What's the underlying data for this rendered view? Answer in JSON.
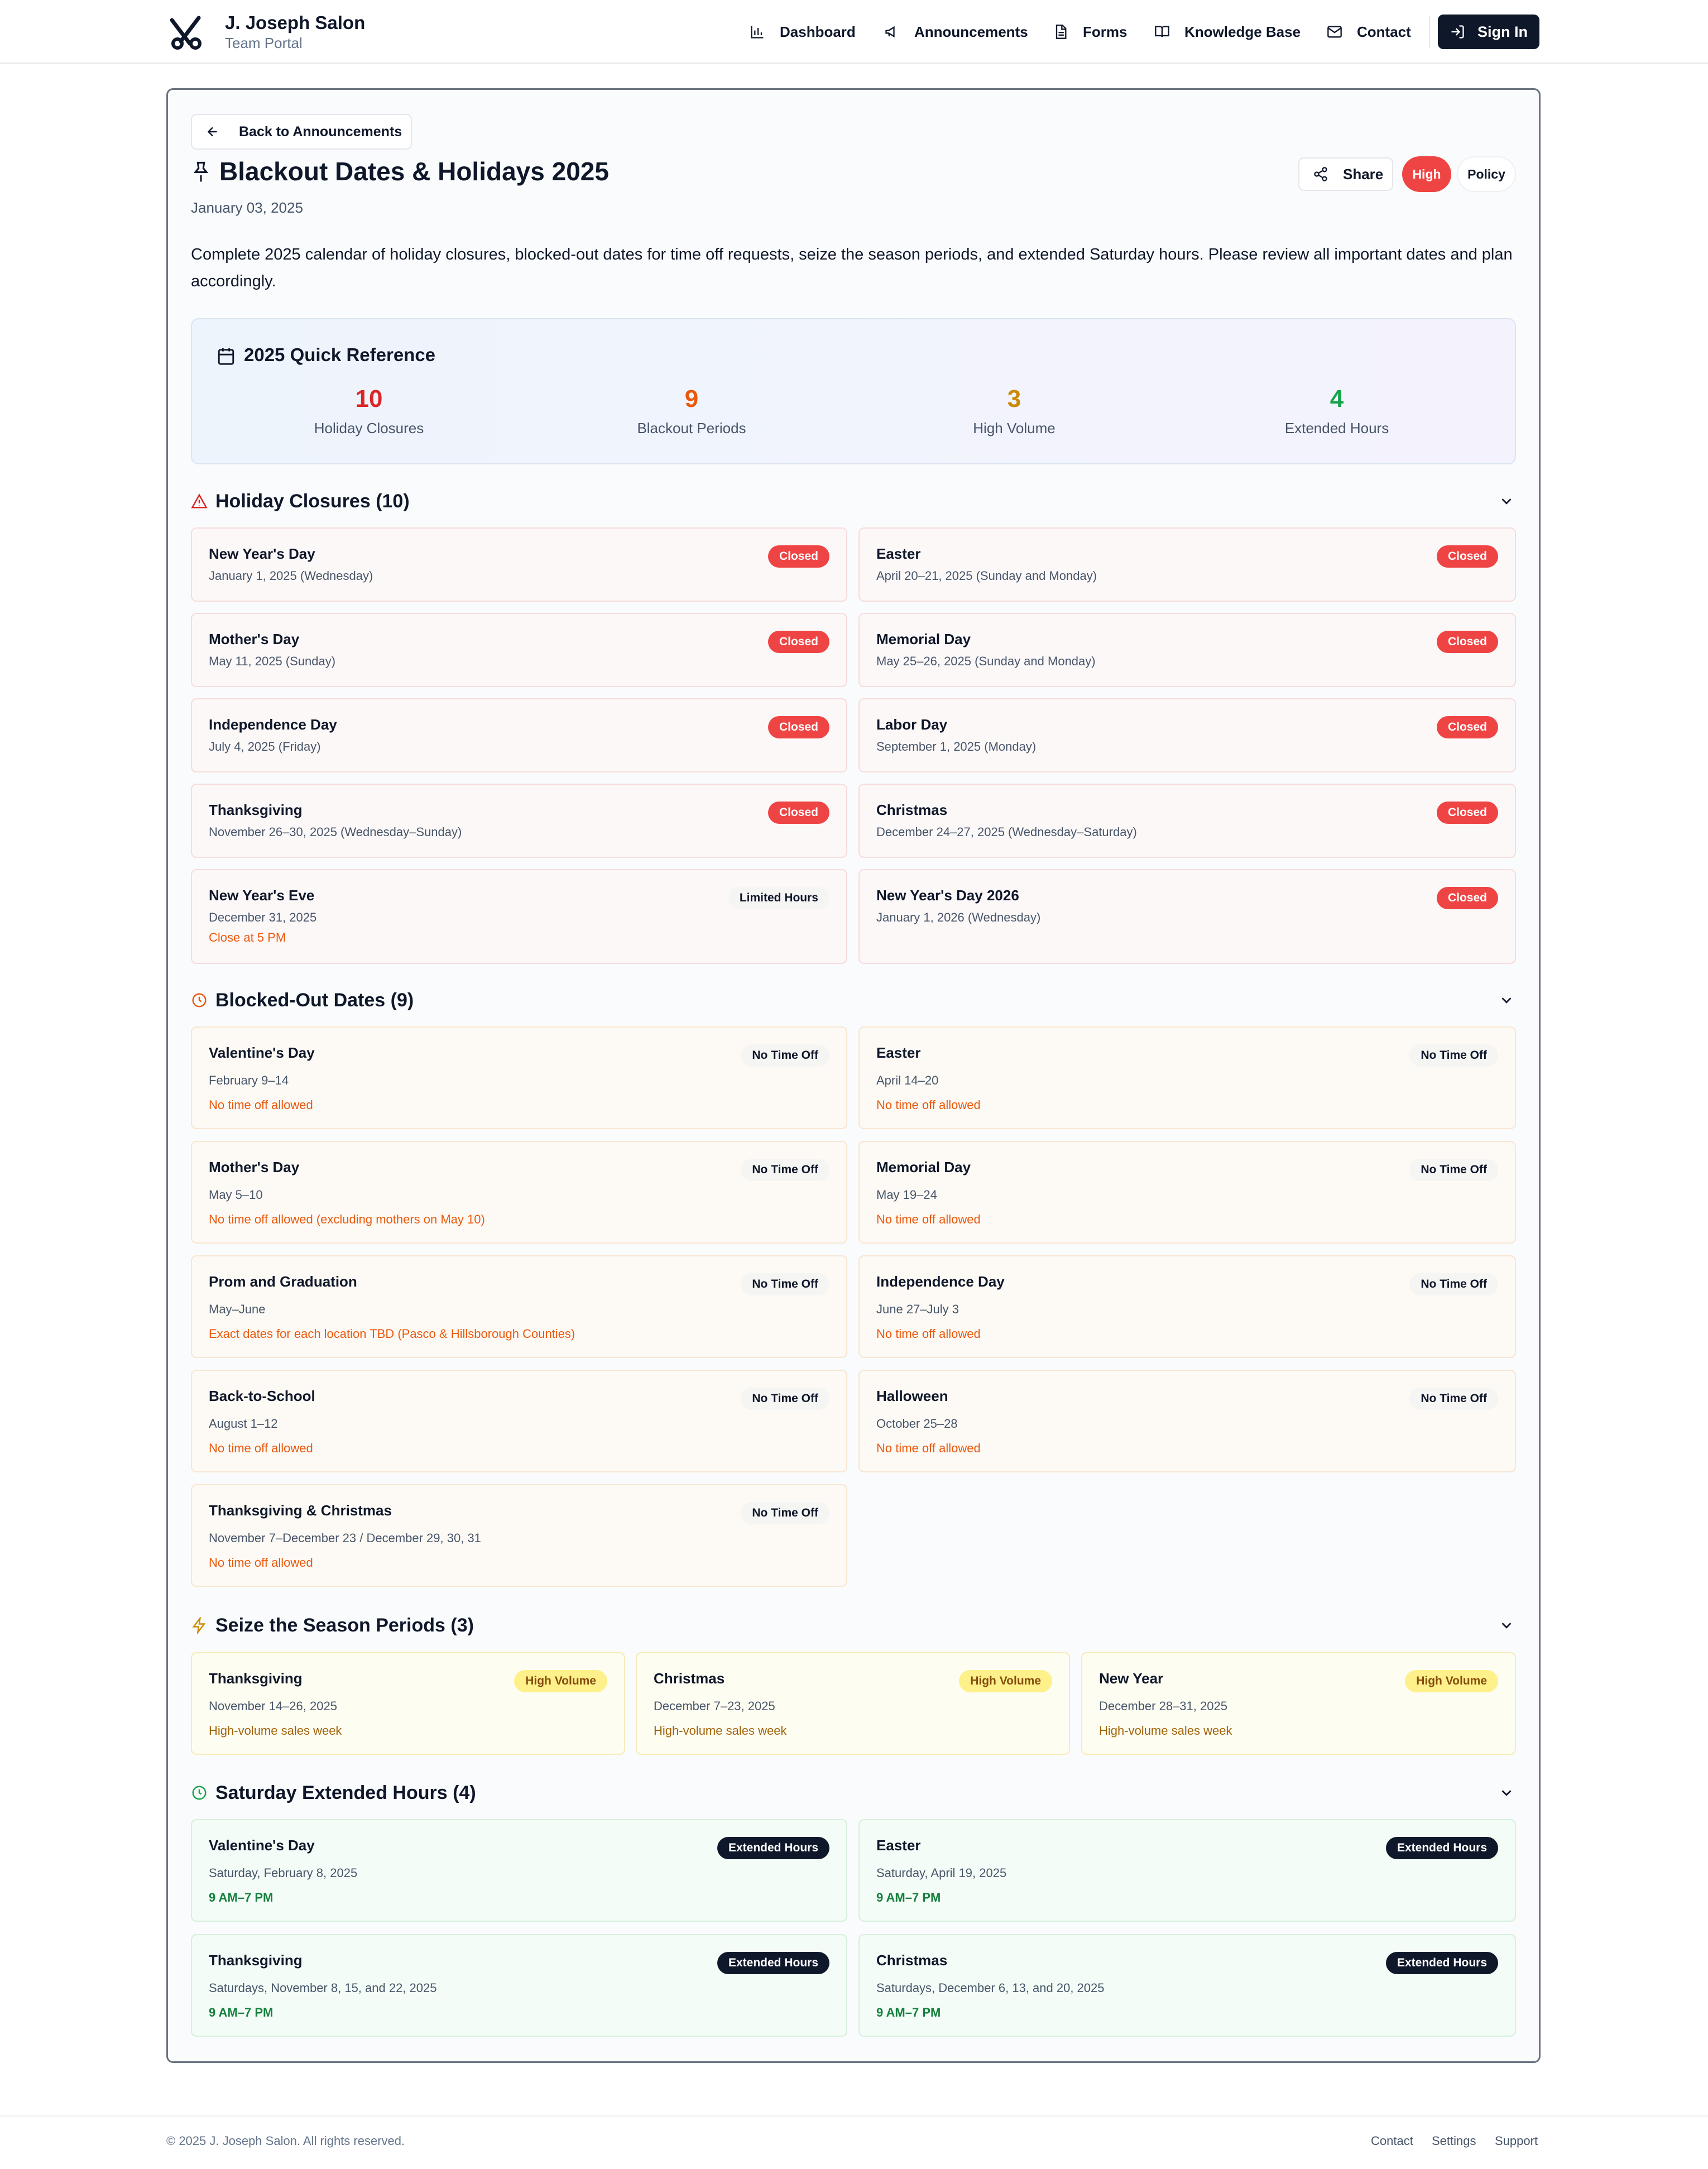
{
  "brand": {
    "name": "J. Joseph Salon",
    "subtitle": "Team Portal"
  },
  "nav": {
    "items": [
      {
        "label": "Dashboard",
        "icon": "bar-chart-icon"
      },
      {
        "label": "Announcements",
        "icon": "megaphone-icon"
      },
      {
        "label": "Forms",
        "icon": "document-icon"
      },
      {
        "label": "Knowledge Base",
        "icon": "book-icon"
      },
      {
        "label": "Contact",
        "icon": "mail-icon"
      }
    ],
    "sign_in": "Sign In"
  },
  "announcement": {
    "back_label": "Back to Announcements",
    "title": "Blackout Dates & Holidays 2025",
    "date": "January 03, 2025",
    "share_label": "Share",
    "priority": "High",
    "category": "Policy",
    "description": "Complete 2025 calendar of holiday closures, blocked-out dates for time off requests, seize the season periods, and extended Saturday hours. Please review all important dates and plan accordingly."
  },
  "quick_reference": {
    "title": "2025 Quick Reference",
    "stats": [
      {
        "value": "10",
        "label": "Holiday Closures",
        "color": "#dc2626"
      },
      {
        "value": "9",
        "label": "Blackout Periods",
        "color": "#ea580c"
      },
      {
        "value": "3",
        "label": "High Volume",
        "color": "#ca8a04"
      },
      {
        "value": "4",
        "label": "Extended Hours",
        "color": "#16a34a"
      }
    ]
  },
  "holiday_closures": {
    "title": "Holiday Closures (10)",
    "items": [
      {
        "name": "New Year's Day",
        "date": "January 1, 2025 (Wednesday)",
        "badge": "Closed"
      },
      {
        "name": "Easter",
        "date": "April 20–21, 2025 (Sunday and Monday)",
        "badge": "Closed"
      },
      {
        "name": "Mother's Day",
        "date": "May 11, 2025 (Sunday)",
        "badge": "Closed"
      },
      {
        "name": "Memorial Day",
        "date": "May 25–26, 2025 (Sunday and Monday)",
        "badge": "Closed"
      },
      {
        "name": "Independence Day",
        "date": "July 4, 2025 (Friday)",
        "badge": "Closed"
      },
      {
        "name": "Labor Day",
        "date": "September 1, 2025 (Monday)",
        "badge": "Closed"
      },
      {
        "name": "Thanksgiving",
        "date": "November 26–30, 2025 (Wednesday–Sunday)",
        "badge": "Closed"
      },
      {
        "name": "Christmas",
        "date": "December 24–27, 2025 (Wednesday–Saturday)",
        "badge": "Closed"
      },
      {
        "name": "New Year's Eve",
        "date": "December 31, 2025",
        "badge": "Limited Hours",
        "note": "Close at 5 PM"
      },
      {
        "name": "New Year's Day 2026",
        "date": "January 1, 2026 (Wednesday)",
        "badge": "Closed"
      }
    ]
  },
  "blocked_out": {
    "title": "Blocked-Out Dates (9)",
    "items": [
      {
        "name": "Valentine's Day",
        "date": "February 9–14",
        "badge": "No Time Off",
        "note": "No time off allowed"
      },
      {
        "name": "Easter",
        "date": "April 14–20",
        "badge": "No Time Off",
        "note": "No time off allowed"
      },
      {
        "name": "Mother's Day",
        "date": "May 5–10",
        "badge": "No Time Off",
        "note": "No time off allowed (excluding mothers on May 10)"
      },
      {
        "name": "Memorial Day",
        "date": "May 19–24",
        "badge": "No Time Off",
        "note": "No time off allowed"
      },
      {
        "name": "Prom and Graduation",
        "date": "May–June",
        "badge": "No Time Off",
        "note": "Exact dates for each location TBD (Pasco & Hillsborough Counties)"
      },
      {
        "name": "Independence Day",
        "date": "June 27–July 3",
        "badge": "No Time Off",
        "note": "No time off allowed"
      },
      {
        "name": "Back-to-School",
        "date": "August 1–12",
        "badge": "No Time Off",
        "note": "No time off allowed"
      },
      {
        "name": "Halloween",
        "date": "October 25–28",
        "badge": "No Time Off",
        "note": "No time off allowed"
      },
      {
        "name": "Thanksgiving & Christmas",
        "date": "November 7–December 23 / December 29, 30, 31",
        "badge": "No Time Off",
        "note": "No time off allowed"
      }
    ]
  },
  "seize_season": {
    "title": "Seize the Season Periods (3)",
    "items": [
      {
        "name": "Thanksgiving",
        "date": "November 14–26, 2025",
        "badge": "High Volume",
        "note": "High-volume sales week"
      },
      {
        "name": "Christmas",
        "date": "December 7–23, 2025",
        "badge": "High Volume",
        "note": "High-volume sales week"
      },
      {
        "name": "New Year",
        "date": "December 28–31, 2025",
        "badge": "High Volume",
        "note": "High-volume sales week"
      }
    ]
  },
  "saturday_hours": {
    "title": "Saturday Extended Hours (4)",
    "items": [
      {
        "name": "Valentine's Day",
        "date": "Saturday, February 8, 2025",
        "badge": "Extended Hours",
        "note": "9 AM–7 PM"
      },
      {
        "name": "Easter",
        "date": "Saturday, April 19, 2025",
        "badge": "Extended Hours",
        "note": "9 AM–7 PM"
      },
      {
        "name": "Thanksgiving",
        "date": "Saturdays, November 8, 15, and 22, 2025",
        "badge": "Extended Hours",
        "note": "9 AM–7 PM"
      },
      {
        "name": "Christmas",
        "date": "Saturdays, December 6, 13, and 20, 2025",
        "badge": "Extended Hours",
        "note": "9 AM–7 PM"
      }
    ]
  },
  "footer": {
    "copyright": "© 2025 J. Joseph Salon. All rights reserved.",
    "links": [
      "Contact",
      "Settings",
      "Support"
    ]
  }
}
